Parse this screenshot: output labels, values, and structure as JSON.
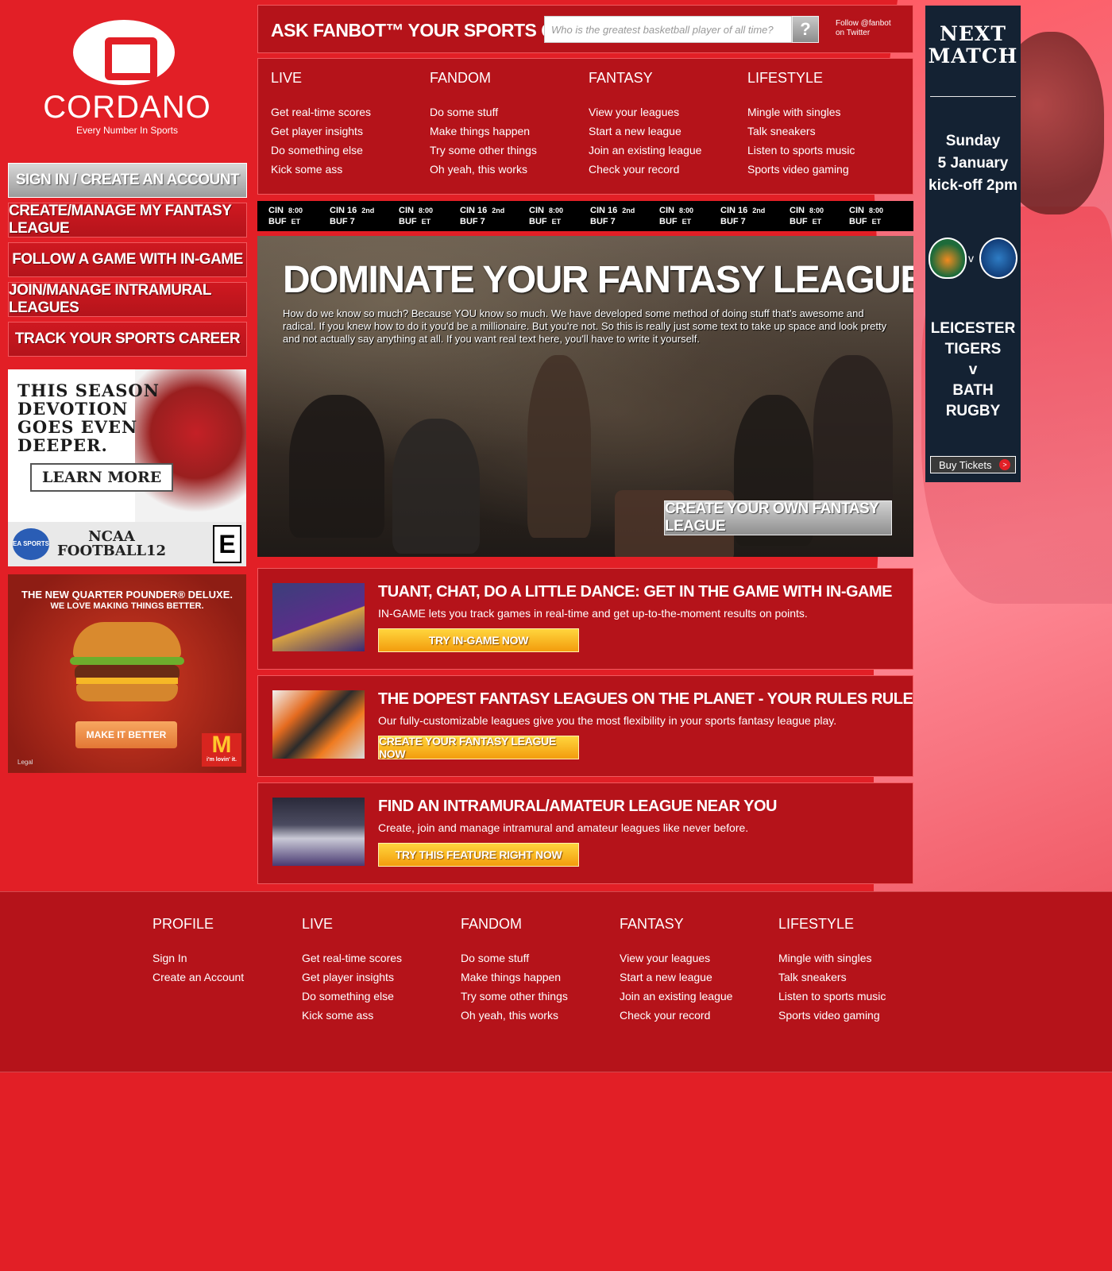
{
  "brand": {
    "name": "CORDANO",
    "tagline": "Every Number In Sports",
    "tm": "TM"
  },
  "colors": {
    "page_bg": "#e21f26",
    "panel_bg": "#b5131a",
    "cta_yellow": "#f5a511"
  },
  "left_nav": [
    {
      "label": "SIGN IN / CREATE AN ACCOUNT"
    },
    {
      "label": "CREATE/MANAGE MY FANTASY LEAGUE"
    },
    {
      "label": "FOLLOW A GAME WITH IN-GAME"
    },
    {
      "label": "JOIN/MANAGE INTRAMURAL LEAGUES"
    },
    {
      "label": "TRACK YOUR SPORTS CAREER"
    }
  ],
  "ads": {
    "ea": {
      "headline": "THIS SEASON DEVOTION GOES EVEN DEEPER.",
      "learn_more": "LEARN MORE",
      "logo": "EA SPORTS",
      "game_line1": "NCAA",
      "game_line2": "FOOTBALL12",
      "rating": "E"
    },
    "mcd": {
      "headline": "THE NEW QUARTER POUNDER® DELUXE.",
      "subhead": "WE LOVE MAKING THINGS BETTER.",
      "button": "MAKE IT BETTER",
      "logo": "M",
      "slogan": "i'm lovin' it.",
      "legal": "Legal"
    },
    "rugby": {
      "next_match": "NEXT MATCH",
      "day": "Sunday",
      "date": "5 January",
      "kickoff": "kick-off 2pm",
      "vs": "v",
      "team1_line1": "LEICESTER",
      "team1_line2": "TIGERS",
      "team2_line1": "BATH",
      "team2_line2": "RUGBY",
      "buy": "Buy Tickets",
      "buy_arrow": ">"
    }
  },
  "ask": {
    "title": "ASK FANBOT™ YOUR SPORTS QUESTION",
    "placeholder": "Who is the greatest basketball player of all time?",
    "button": "?",
    "twitter_line1": "Follow @fanbot",
    "twitter_line2": "on Twitter"
  },
  "menu": [
    {
      "head": "LIVE",
      "items": [
        "Get real-time scores",
        "Get player insights",
        "Do something else",
        "Kick some ass"
      ]
    },
    {
      "head": "FANDOM",
      "items": [
        "Do some stuff",
        "Make things happen",
        "Try some other things",
        "Oh yeah, this works"
      ]
    },
    {
      "head": "FANTASY",
      "items": [
        "View your leagues",
        "Start a new league",
        "Join an existing league",
        "Check your record"
      ]
    },
    {
      "head": "LIFESTYLE",
      "items": [
        "Mingle with singles",
        "Talk sneakers",
        "Listen to sports music",
        "Sports video gaming"
      ]
    }
  ],
  "ticker": [
    {
      "l1": "CIN",
      "s1": "8:00",
      "l2": "BUF",
      "s2": "ET"
    },
    {
      "l1": "CIN 16",
      "s1": "2nd",
      "l2": "BUF 7",
      "s2": ""
    },
    {
      "l1": "CIN",
      "s1": "8:00",
      "l2": "BUF",
      "s2": "ET"
    },
    {
      "l1": "CIN 16",
      "s1": "2nd",
      "l2": "BUF 7",
      "s2": ""
    },
    {
      "l1": "CIN",
      "s1": "8:00",
      "l2": "BUF",
      "s2": "ET"
    },
    {
      "l1": "CIN 16",
      "s1": "2nd",
      "l2": "BUF 7",
      "s2": ""
    },
    {
      "l1": "CIN",
      "s1": "8:00",
      "l2": "BUF",
      "s2": "ET"
    },
    {
      "l1": "CIN 16",
      "s1": "2nd",
      "l2": "BUF 7",
      "s2": ""
    },
    {
      "l1": "CIN",
      "s1": "8:00",
      "l2": "BUF",
      "s2": "ET"
    },
    {
      "l1": "CIN",
      "s1": "8:00",
      "l2": "BUF",
      "s2": "ET"
    }
  ],
  "hero": {
    "title": "DOMINATE YOUR FANTASY LEAGUE",
    "desc": "How do we know so much? Because YOU know so much. We have developed some method of doing stuff that's awesome and radical. If you knew how to do it you'd be a millionaire. But you're not. So this is really just some text to take up space and look pretty and not actually say anything at all. If you want real text here, you'll have to write it yourself.",
    "cta": "CREATE YOUR OWN FANTASY LEAGUE"
  },
  "features": [
    {
      "title": "TUANT, CHAT, DO A LITTLE DANCE: GET IN THE GAME WITH IN-GAME",
      "desc": "IN-GAME lets you track games in real-time and get up-to-the-moment results on points.",
      "button": "TRY IN-GAME NOW"
    },
    {
      "title": "THE DOPEST FANTASY LEAGUES ON THE PLANET - YOUR RULES RULE",
      "desc": "Our fully-customizable leagues give you the most flexibility in your sports fantasy league play.",
      "button": "CREATE YOUR FANTASY LEAGUE NOW"
    },
    {
      "title": "FIND AN INTRAMURAL/AMATEUR LEAGUE NEAR YOU",
      "desc": "Create, join and manage intramural and amateur leagues like never before.",
      "button": "TRY THIS FEATURE RIGHT NOW"
    }
  ],
  "footer": [
    {
      "head": "PROFILE",
      "items": [
        "Sign In",
        "Create an Account"
      ]
    },
    {
      "head": "LIVE",
      "items": [
        "Get real-time scores",
        "Get player insights",
        "Do something else",
        "Kick some ass"
      ]
    },
    {
      "head": "FANDOM",
      "items": [
        "Do some stuff",
        "Make things happen",
        "Try some other things",
        "Oh yeah, this works"
      ]
    },
    {
      "head": "FANTASY",
      "items": [
        "View your leagues",
        "Start a new league",
        "Join an existing league",
        "Check your record"
      ]
    },
    {
      "head": "LIFESTYLE",
      "items": [
        "Mingle with singles",
        "Talk sneakers",
        "Listen to sports music",
        "Sports video gaming"
      ]
    }
  ]
}
